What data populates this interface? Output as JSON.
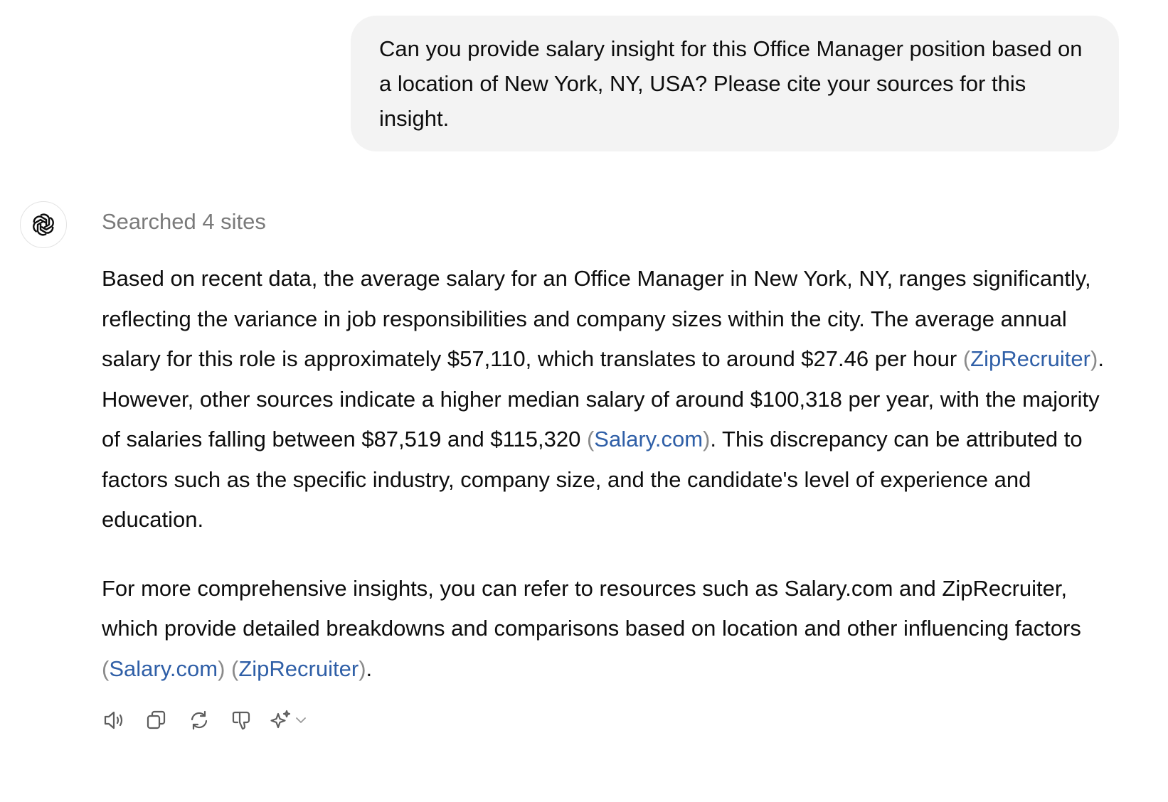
{
  "user_message": {
    "text": "Can you provide salary insight for this Office Manager position based on a location of New York, NY, USA? Please cite your sources for this insight."
  },
  "assistant": {
    "avatar_icon": "openai-logo-icon",
    "search_status": "Searched 4 sites",
    "paragraph1": {
      "part1": "Based on recent data, the average salary for an Office Manager in New York, NY, ranges significantly, reflecting the variance in job responsibilities and company sizes within the city. The average annual salary for this role is approximately $57,110, which translates to around $27.46 per hour ",
      "cite1": "ZipRecruiter",
      "part2": ". However, other sources indicate a higher median salary of around $100,318 per year, with the majority of salaries falling between $87,519 and $115,320 ",
      "cite2": "Salary.com",
      "part3": ". This discrepancy can be attributed to factors such as the specific industry, company size, and the candidate's level of experience and education."
    },
    "paragraph2": {
      "part1": "For more comprehensive insights, you can refer to resources such as Salary.com and ZipRecruiter, which provide detailed breakdowns and comparisons based on location and other influencing factors ",
      "cite1": "Salary.com",
      "cite2": "ZipRecruiter",
      "part2": "."
    }
  },
  "actions": {
    "icons": [
      "read-aloud-icon",
      "copy-icon",
      "regenerate-icon",
      "thumbs-down-icon",
      "sparkle-icon",
      "chevron-down-icon"
    ]
  },
  "colors": {
    "link": "#2f5fa7",
    "bubble_bg": "#f3f3f3",
    "muted_text": "#7a7a7a",
    "icon": "#5d5d5d"
  }
}
